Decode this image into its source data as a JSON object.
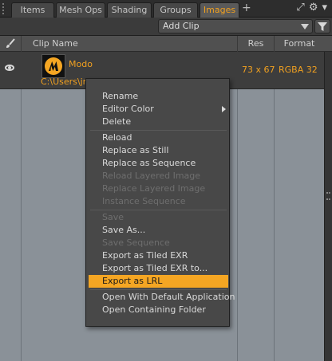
{
  "tabs": [
    {
      "label": "Items"
    },
    {
      "label": "Mesh Ops"
    },
    {
      "label": "Shading"
    },
    {
      "label": "Groups"
    },
    {
      "label": "Images"
    }
  ],
  "tab_add": "+",
  "toolbar": {
    "add_clip_label": "Add Clip"
  },
  "columns": {
    "clip_name": "Clip Name",
    "res": "Res",
    "format": "Format"
  },
  "clip": {
    "name": "Modo",
    "path": "C:\\Users\\jm",
    "res": "73 x 67",
    "format": "RGBA 32"
  },
  "context_menu": [
    {
      "label": "Rename",
      "disabled": false
    },
    {
      "label": "Editor Color",
      "disabled": false,
      "submenu": true
    },
    {
      "label": "Delete",
      "disabled": false
    },
    {
      "separator": true
    },
    {
      "label": "Reload",
      "disabled": false
    },
    {
      "label": "Replace as Still",
      "disabled": false
    },
    {
      "label": "Replace as Sequence",
      "disabled": false
    },
    {
      "label": "Reload Layered Image",
      "disabled": true
    },
    {
      "label": "Replace Layered Image",
      "disabled": true
    },
    {
      "label": "Instance Sequence",
      "disabled": true
    },
    {
      "separator": true
    },
    {
      "label": "Save",
      "disabled": true
    },
    {
      "label": "Save As...",
      "disabled": false
    },
    {
      "label": "Save Sequence",
      "disabled": true
    },
    {
      "label": "Export as Tiled EXR",
      "disabled": false
    },
    {
      "label": "Export as Tiled EXR to...",
      "disabled": false
    },
    {
      "label": "Export as LRL",
      "disabled": false,
      "highlighted": true
    },
    {
      "separator": true
    },
    {
      "label": "Open With Default Application",
      "disabled": false
    },
    {
      "label": "Open Containing Folder",
      "disabled": false
    }
  ],
  "colors": {
    "accent": "#f0a020",
    "highlight": "#f5a623",
    "list_bg": "#8a9198"
  },
  "icons": [
    "brush-icon",
    "eye-icon",
    "funnel-icon",
    "gear-icon",
    "expand-icon",
    "chevron-down-icon"
  ]
}
